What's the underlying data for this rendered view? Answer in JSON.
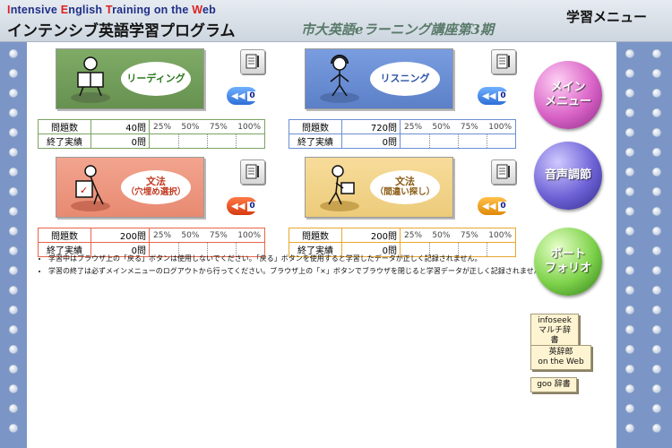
{
  "header": {
    "brand_en": {
      "i": "I",
      "ntensive": "ntensive ",
      "e": "E",
      "nglish": "nglish ",
      "t": "T",
      "raining": "raining on the ",
      "w": "W",
      "eb": "eb"
    },
    "brand_jp": "インテンシブ英語学習プログラム",
    "course_title": "市大英語eラーニング講座第3期",
    "page_label": "学習メニュー"
  },
  "stat_labels": {
    "count": "問題数",
    "done": "終了実績"
  },
  "ticks": [
    "25%",
    "50%",
    "75%",
    "100%"
  ],
  "modules": [
    {
      "key": "reading",
      "label_l1": "リーディング",
      "label_l2": "",
      "count": "40問",
      "done": "0問",
      "back_count": "0",
      "color": "#79a461"
    },
    {
      "key": "listening",
      "label_l1": "リスニング",
      "label_l2": "",
      "count": "720問",
      "done": "0問",
      "back_count": "0",
      "color": "#6b8ed1"
    },
    {
      "key": "grammar1",
      "label_l1": "文法",
      "label_l2": "（穴埋め選択）",
      "count": "200問",
      "done": "0問",
      "back_count": "0",
      "color": "#e5664a"
    },
    {
      "key": "grammar2",
      "label_l1": "文法",
      "label_l2": "（間違い探し）",
      "count": "200問",
      "done": "0問",
      "back_count": "0",
      "color": "#e8a830"
    }
  ],
  "notes": [
    "学習中はブラウザ上の「戻る」ボタンは使用しないでください。「戻る」ボタンを使用すると学習したデータが正しく記録されません。",
    "学習の終了は必ずメインメニューのログアウトから行ってください。ブラウザ上の「×」ボタンでブラウザを閉じると学習データが正しく記録されません。"
  ],
  "side": {
    "main_menu": [
      "メイン",
      "メニュー"
    ],
    "audio": "音声調節",
    "portfolio": [
      "ポート",
      "フォリオ"
    ]
  },
  "dictionaries": {
    "infoseek": [
      "infoseek",
      "マルチ辞書"
    ],
    "eijiro": [
      "英辞郎",
      "on the Web"
    ],
    "goo": "goo 辞書"
  }
}
